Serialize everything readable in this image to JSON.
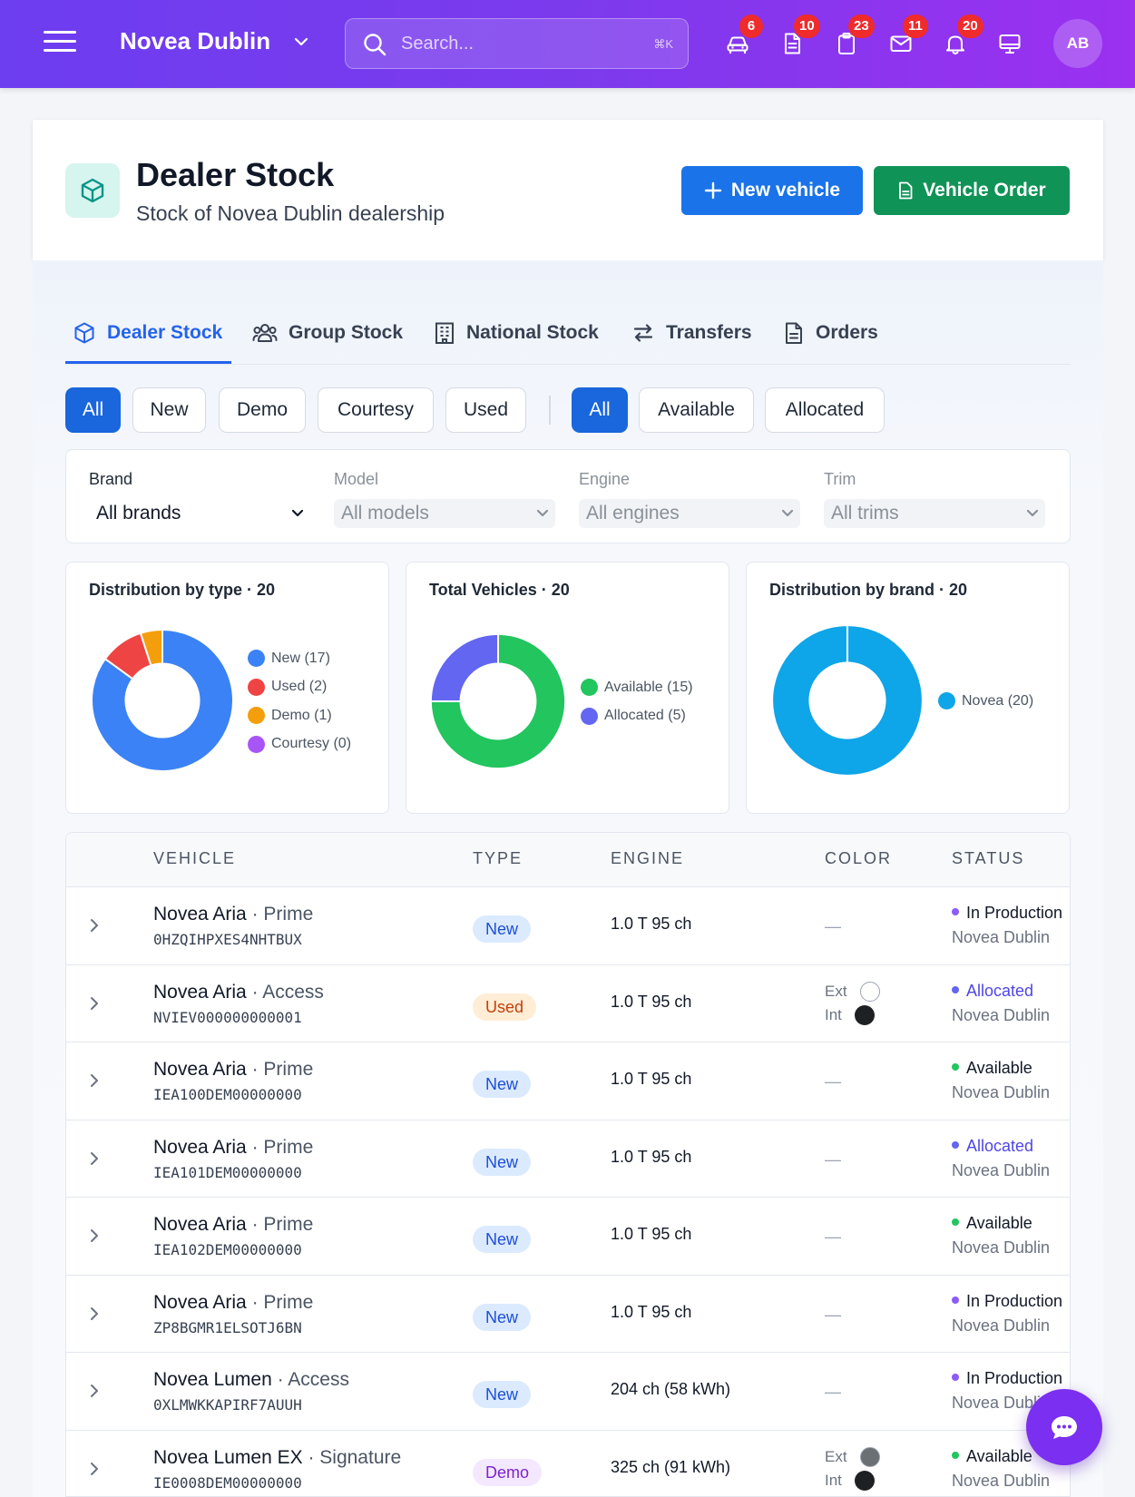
{
  "topbar": {
    "dealer_name": "Novea Dublin",
    "search_placeholder": "Search...",
    "search_shortcut": "⌘K",
    "icons": [
      {
        "name": "car-icon",
        "badge": "6"
      },
      {
        "name": "document-icon",
        "badge": "10"
      },
      {
        "name": "clipboard-icon",
        "badge": "23"
      },
      {
        "name": "mail-icon",
        "badge": "11"
      },
      {
        "name": "bell-icon",
        "badge": "20"
      },
      {
        "name": "monitor-icon",
        "badge": ""
      }
    ],
    "avatar_initials": "AB"
  },
  "header": {
    "title": "Dealer Stock",
    "subtitle": "Stock of Novea Dublin dealership",
    "new_vehicle_label": "New vehicle",
    "vehicle_order_label": "Vehicle Order"
  },
  "tabs": [
    {
      "label": "Dealer Stock",
      "icon": "box-icon",
      "active": true
    },
    {
      "label": "Group Stock",
      "icon": "users-icon",
      "active": false
    },
    {
      "label": "National Stock",
      "icon": "building-icon",
      "active": false
    },
    {
      "label": "Transfers",
      "icon": "transfer-icon",
      "active": false
    },
    {
      "label": "Orders",
      "icon": "document-icon",
      "active": false
    }
  ],
  "type_filters": [
    "All",
    "New",
    "Demo",
    "Courtesy",
    "Used"
  ],
  "status_filters": [
    "All",
    "Available",
    "Allocated"
  ],
  "selectors": [
    {
      "label": "Brand",
      "value": "All brands",
      "disabled": false
    },
    {
      "label": "Model",
      "value": "All models",
      "disabled": true
    },
    {
      "label": "Engine",
      "value": "All engines",
      "disabled": true
    },
    {
      "label": "Trim",
      "value": "All trims",
      "disabled": true
    }
  ],
  "chart_data": [
    {
      "type": "pie",
      "title": "Distribution by type · 20",
      "categories": [
        "New (17)",
        "Used (2)",
        "Demo (1)",
        "Courtesy (0)"
      ],
      "values": [
        17,
        2,
        1,
        0
      ],
      "colors": [
        "#3b82f6",
        "#ef4444",
        "#f59e0b",
        "#a855f7"
      ],
      "legend": "right"
    },
    {
      "type": "pie",
      "title": "Total Vehicles · 20",
      "categories": [
        "Available (15)",
        "Allocated (5)"
      ],
      "values": [
        15,
        5
      ],
      "colors": [
        "#22c55e",
        "#6366f1"
      ],
      "legend": "right"
    },
    {
      "type": "pie",
      "title": "Distribution by brand · 20",
      "categories": [
        "Novea (20)"
      ],
      "values": [
        20
      ],
      "colors": [
        "#0ea5e9"
      ],
      "legend": "right"
    }
  ],
  "table": {
    "columns": [
      "VEHICLE",
      "TYPE",
      "ENGINE",
      "COLOR",
      "STATUS"
    ],
    "rows": [
      {
        "model": "Novea Aria",
        "trim": "Prime",
        "vin": "0HZQIHPXES4NHTBUX",
        "type": "New",
        "type_class": "new",
        "engine": "1.0 T 95 ch",
        "color": null,
        "status": "In Production",
        "status_color": "#8b5cf6",
        "status_text_color": "#111827",
        "location": "Novea Dublin"
      },
      {
        "model": "Novea Aria",
        "trim": "Access",
        "vin": "NVIEV000000000001",
        "type": "Used",
        "type_class": "used",
        "engine": "1.0 T 95 ch",
        "color": {
          "ext_label": "Ext",
          "int_label": "Int",
          "ext": "#ffffff",
          "int": "#1f2023"
        },
        "status": "Allocated",
        "status_color": "#6366f1",
        "status_text_color": "#4f46e5",
        "location": "Novea Dublin"
      },
      {
        "model": "Novea Aria",
        "trim": "Prime",
        "vin": "IEA100DEM00000000",
        "type": "New",
        "type_class": "new",
        "engine": "1.0 T 95 ch",
        "color": null,
        "status": "Available",
        "status_color": "#22c55e",
        "status_text_color": "#111827",
        "location": "Novea Dublin"
      },
      {
        "model": "Novea Aria",
        "trim": "Prime",
        "vin": "IEA101DEM00000000",
        "type": "New",
        "type_class": "new",
        "engine": "1.0 T 95 ch",
        "color": null,
        "status": "Allocated",
        "status_color": "#6366f1",
        "status_text_color": "#4f46e5",
        "location": "Novea Dublin"
      },
      {
        "model": "Novea Aria",
        "trim": "Prime",
        "vin": "IEA102DEM00000000",
        "type": "New",
        "type_class": "new",
        "engine": "1.0 T 95 ch",
        "color": null,
        "status": "Available",
        "status_color": "#22c55e",
        "status_text_color": "#111827",
        "location": "Novea Dublin"
      },
      {
        "model": "Novea Aria",
        "trim": "Prime",
        "vin": "ZP8BGMR1ELSOTJ6BN",
        "type": "New",
        "type_class": "new",
        "engine": "1.0 T 95 ch",
        "color": null,
        "status": "In Production",
        "status_color": "#8b5cf6",
        "status_text_color": "#111827",
        "location": "Novea Dublin"
      },
      {
        "model": "Novea Lumen",
        "trim": "Access",
        "vin": "0XLMWKKAPIRF7AUUH",
        "type": "New",
        "type_class": "new",
        "engine": "204 ch (58 kWh)",
        "color": null,
        "status": "In Production",
        "status_color": "#8b5cf6",
        "status_text_color": "#111827",
        "location": "Novea Dublin"
      },
      {
        "model": "Novea Lumen EX",
        "trim": "Signature",
        "vin": "IE0008DEM00000000",
        "type": "Demo",
        "type_class": "demo",
        "engine": "325 ch (91 kWh)",
        "color": {
          "ext_label": "Ext",
          "int_label": "Int",
          "ext": "#6b7075",
          "int": "#1f2023"
        },
        "status": "Available",
        "status_color": "#22c55e",
        "status_text_color": "#111827",
        "location": "Novea Dublin"
      }
    ]
  },
  "chat_button_icon": "chat-icon"
}
